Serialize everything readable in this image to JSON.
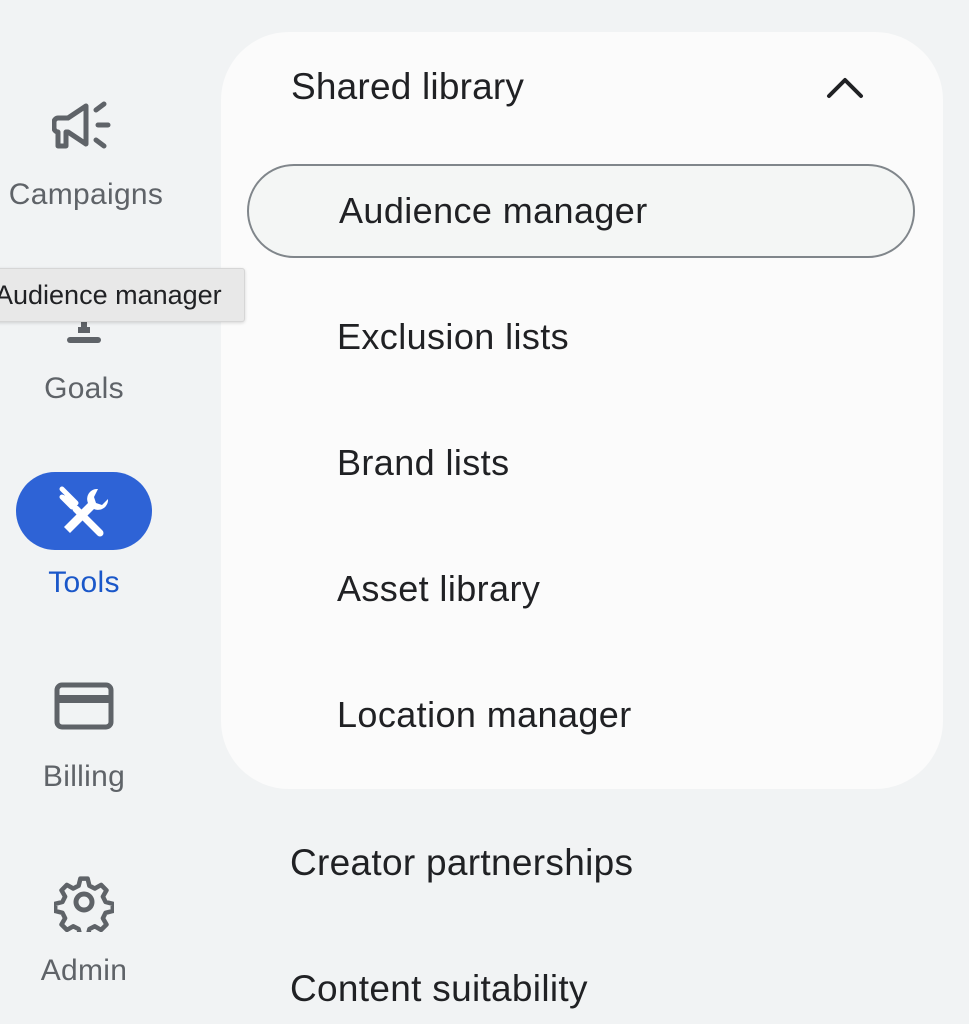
{
  "rail": {
    "items": [
      {
        "label": "Campaigns",
        "icon": "megaphone-icon"
      },
      {
        "label": "Goals",
        "icon": "trophy-icon"
      },
      {
        "label": "Tools",
        "icon": "tools-icon",
        "active": true
      },
      {
        "label": "Billing",
        "icon": "credit-card-icon"
      },
      {
        "label": "Admin",
        "icon": "gear-icon"
      }
    ]
  },
  "tooltip": {
    "text": "Audience manager"
  },
  "panel": {
    "section_title": "Shared library",
    "items": [
      {
        "label": "Audience manager",
        "selected": true
      },
      {
        "label": "Exclusion lists"
      },
      {
        "label": "Brand lists"
      },
      {
        "label": "Asset library"
      },
      {
        "label": "Location manager"
      }
    ],
    "other_sections": [
      {
        "label": "Creator partnerships"
      },
      {
        "label": "Content suitability"
      }
    ]
  },
  "colors": {
    "accent": "#2e63d6",
    "active_text": "#1a57c9",
    "background": "#f1f3f4",
    "card": "#fbfbfb"
  }
}
